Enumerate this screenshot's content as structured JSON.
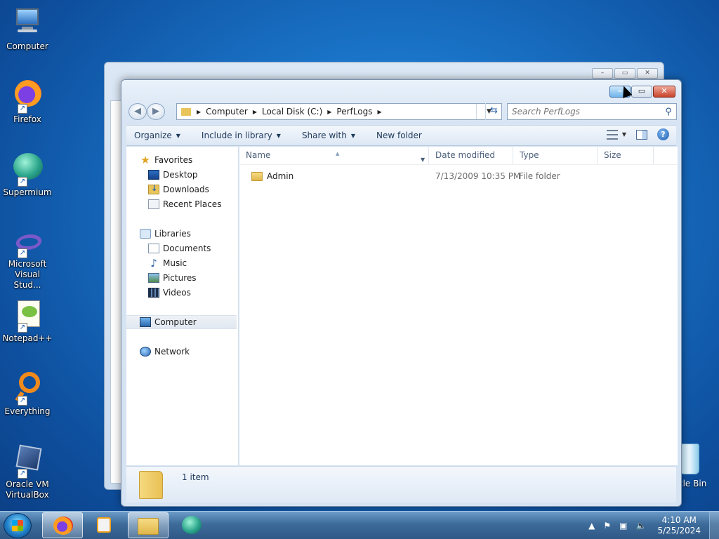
{
  "desktop": {
    "icons": [
      {
        "label": "Computer"
      },
      {
        "label": "Firefox"
      },
      {
        "label": "Supermium"
      },
      {
        "label": "Microsoft Visual Stud..."
      },
      {
        "label": "Notepad++"
      },
      {
        "label": "Everything"
      },
      {
        "label": "Oracle VM VirtualBox"
      }
    ],
    "recycle_bin_label": "cle Bin"
  },
  "explorer": {
    "caption_buttons": {
      "minimize": "–",
      "maximize": "▭",
      "close": "✕"
    },
    "breadcrumb": [
      "Computer",
      "Local Disk (C:)",
      "PerfLogs"
    ],
    "search": {
      "placeholder": "Search PerfLogs"
    },
    "toolbar": {
      "organize": "Organize",
      "include_in_library": "Include in library",
      "share_with": "Share with",
      "new_folder": "New folder"
    },
    "nav": {
      "favorites": "Favorites",
      "desktop": "Desktop",
      "downloads": "Downloads",
      "recent_places": "Recent Places",
      "libraries": "Libraries",
      "documents": "Documents",
      "music": "Music",
      "pictures": "Pictures",
      "videos": "Videos",
      "computer": "Computer",
      "network": "Network"
    },
    "columns": {
      "name": "Name",
      "date_modified": "Date modified",
      "type": "Type",
      "size": "Size"
    },
    "rows": [
      {
        "name": "Admin",
        "date_modified": "7/13/2009 10:35 PM",
        "type": "File folder",
        "size": ""
      }
    ],
    "status": {
      "count": "1 item"
    }
  },
  "taskbar": {
    "apps": [
      {
        "name": "firefox",
        "icon": "firefox-icon",
        "color": "#e8571e"
      },
      {
        "name": "media-player",
        "icon": "media-player-icon",
        "color": "#f0a020"
      },
      {
        "name": "explorer",
        "icon": "folder-icon",
        "color": "#e8c45a"
      },
      {
        "name": "supermium",
        "icon": "supermium-icon",
        "color": "#2aa58a"
      }
    ],
    "clock": {
      "time": "4:10 AM",
      "date": "5/25/2024"
    }
  }
}
